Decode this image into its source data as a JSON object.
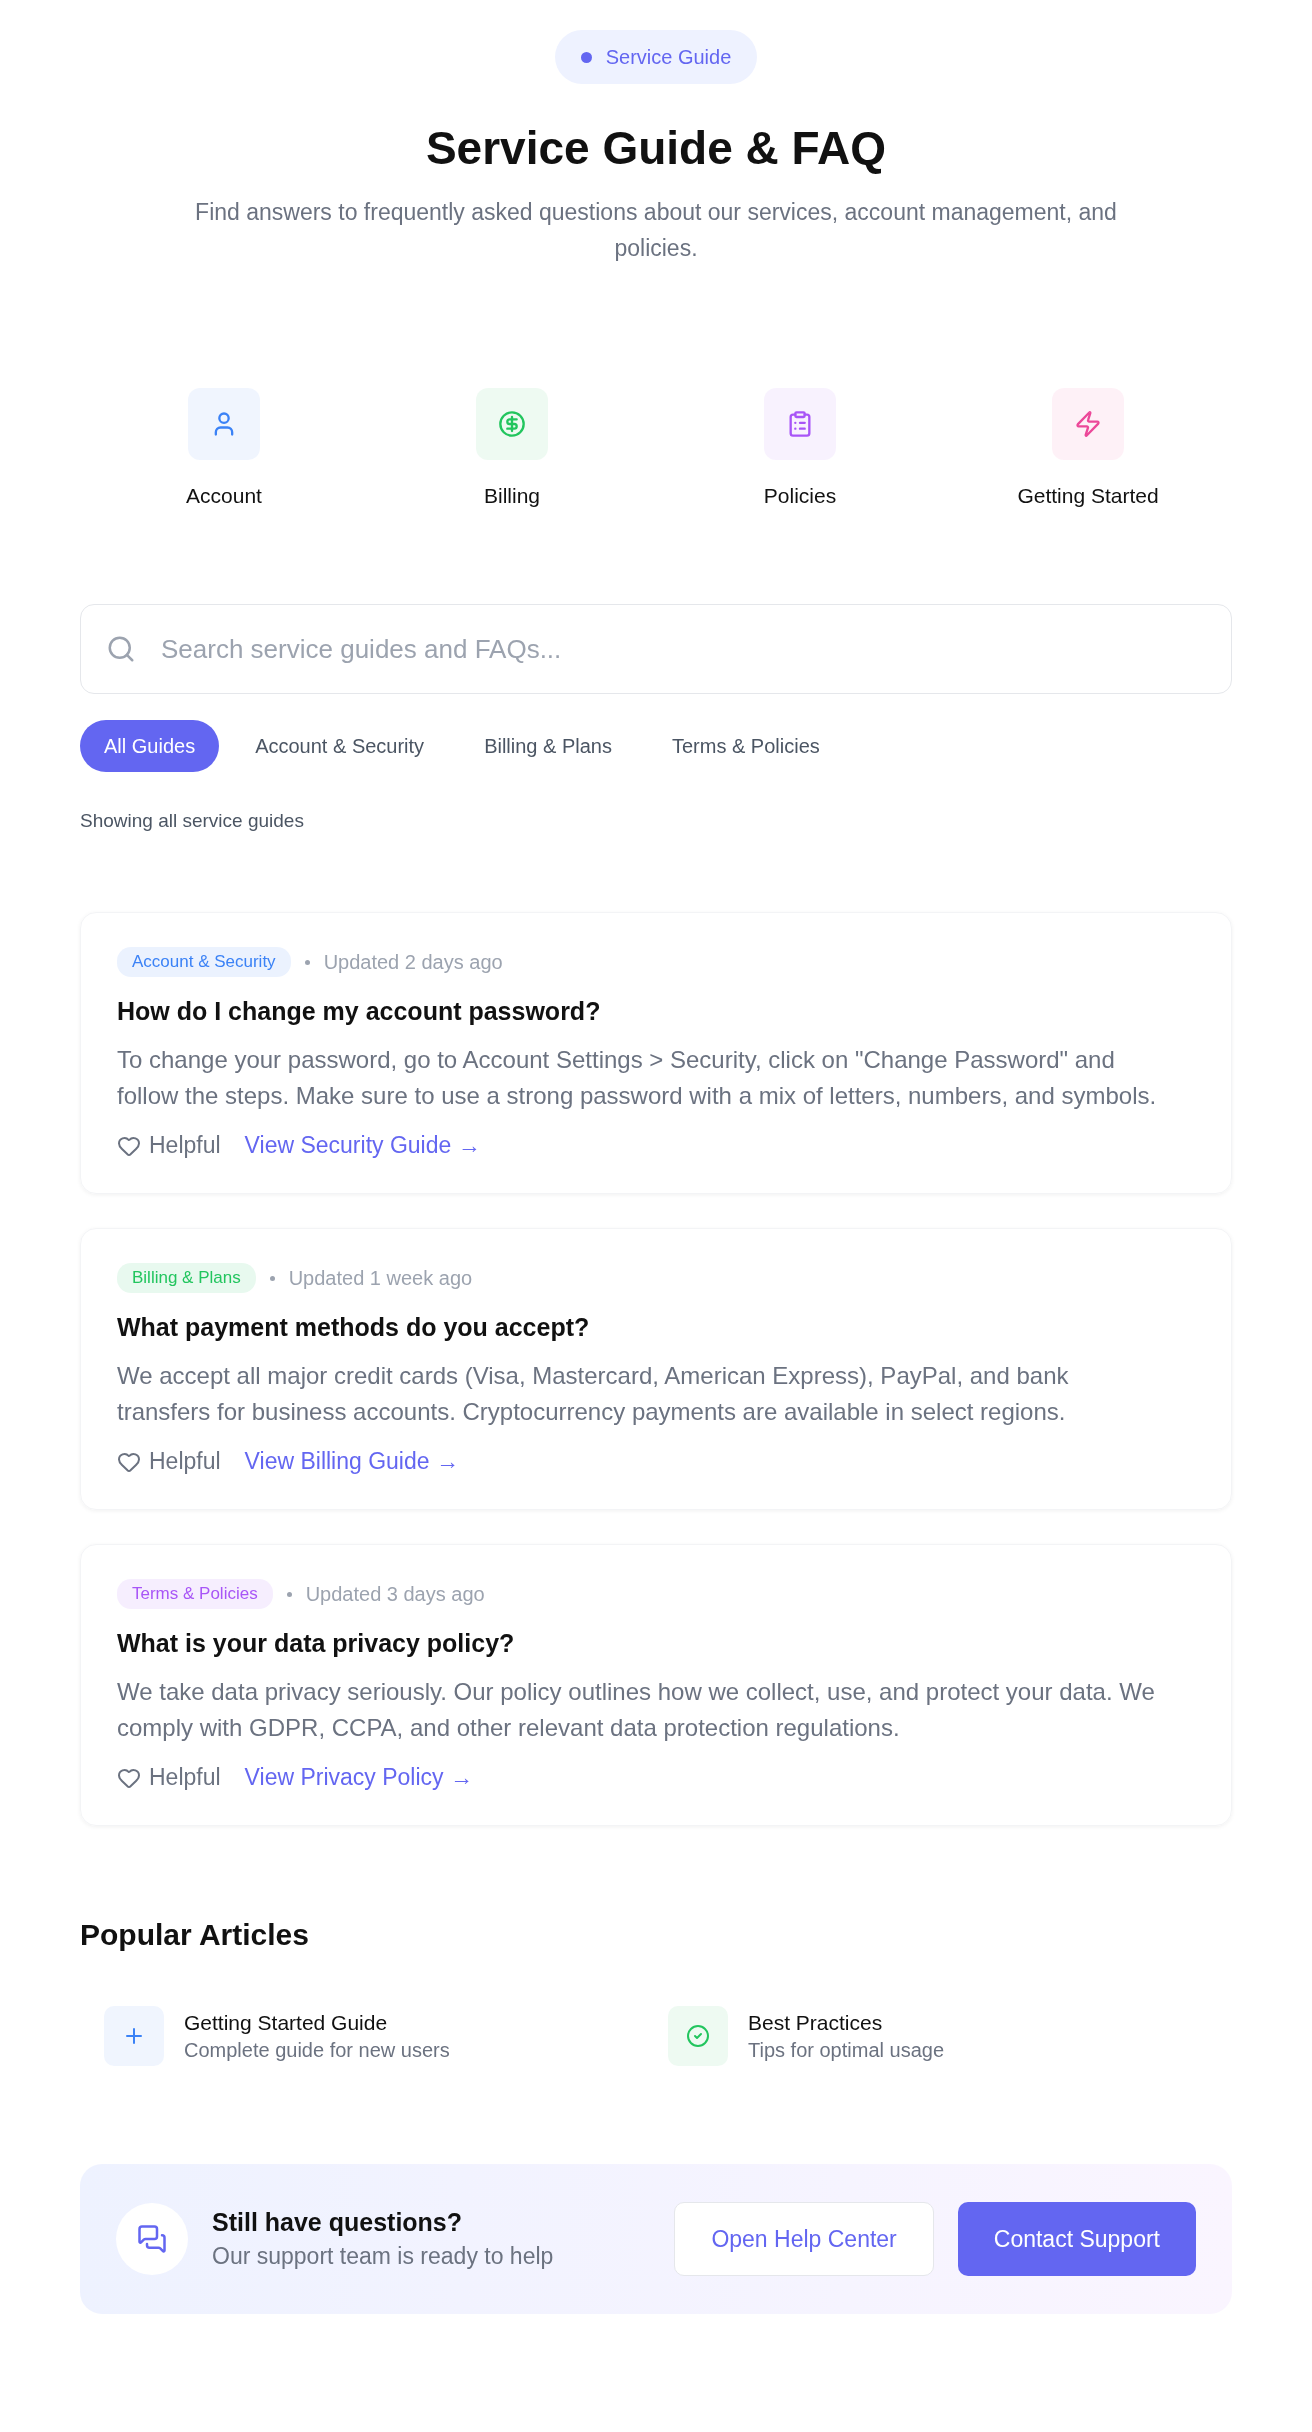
{
  "badge": {
    "label": "Service Guide"
  },
  "header": {
    "title": "Service Guide & FAQ",
    "subtitle": "Find answers to frequently asked questions about our services, account management, and policies."
  },
  "categories": [
    {
      "label": "Account",
      "kind": "user",
      "color": "#3b82f6"
    },
    {
      "label": "Billing",
      "kind": "dollar",
      "color": "#22c55e"
    },
    {
      "label": "Policies",
      "kind": "clipboard",
      "color": "#a855f7"
    },
    {
      "label": "Getting Started",
      "kind": "bolt",
      "color": "#ec4899"
    }
  ],
  "search": {
    "placeholder": "Search service guides and FAQs..."
  },
  "tabs": [
    {
      "label": "All Guides",
      "selected": true
    },
    {
      "label": "Account & Security",
      "selected": false
    },
    {
      "label": "Billing & Plans",
      "selected": false
    },
    {
      "label": "Terms & Policies",
      "selected": false
    }
  ],
  "result_note": "Showing all service guides",
  "faqs": [
    {
      "tag": "Account & Security",
      "color": "#3b82f6",
      "updated": "Updated 2 days ago",
      "question": "How do I change my account password?",
      "answer": "To change your password, go to Account Settings > Security, click on \"Change Password\" and follow the steps. Make sure to use a strong password with a mix of letters, numbers, and symbols.",
      "helpful": "Helpful",
      "link": "View Security Guide →"
    },
    {
      "tag": "Billing & Plans",
      "color": "#22c55e",
      "updated": "Updated 1 week ago",
      "question": "What payment methods do you accept?",
      "answer": "We accept all major credit cards (Visa, Mastercard, American Express), PayPal, and bank transfers for business accounts. Cryptocurrency payments are available in select regions.",
      "helpful": "Helpful",
      "link": "View Billing Guide →"
    },
    {
      "tag": "Terms & Policies",
      "color": "#a855f7",
      "updated": "Updated 3 days ago",
      "question": "What is your data privacy policy?",
      "answer": "We take data privacy seriously. Our policy outlines how we collect, use, and protect your data. We comply with GDPR, CCPA, and other relevant data protection regulations.",
      "helpful": "Helpful",
      "link": "View Privacy Policy →"
    }
  ],
  "popular": {
    "title": "Popular Articles",
    "articles": [
      {
        "title": "Getting Started Guide",
        "description": "Complete guide for new users",
        "kind": "plus",
        "color": "#3b82f6"
      },
      {
        "title": "Best Practices",
        "description": "Tips for optimal usage",
        "kind": "check",
        "color": "#22c55e"
      }
    ]
  },
  "contact": {
    "title": "Still have questions?",
    "subtitle": "Our support team is ready to help",
    "buttons": [
      {
        "label": "Open Help Center",
        "kind": "secondary"
      },
      {
        "label": "Contact Support",
        "kind": "primary"
      }
    ]
  }
}
